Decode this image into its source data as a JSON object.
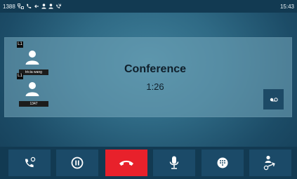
{
  "status_bar": {
    "account": "1388",
    "time": "15:43",
    "icons": [
      "network-icon",
      "phone-icon",
      "forward-icon",
      "user-icon",
      "user-icon",
      "missed-call-icon"
    ]
  },
  "conference": {
    "title": "Conference",
    "duration": "1:26",
    "participants": [
      {
        "line_badge": "L1",
        "name": "tricia wang",
        "icon": "avatar-icon"
      },
      {
        "line_badge": "L1",
        "name": "1347",
        "icon": "avatar-icon"
      }
    ],
    "side_action": {
      "icon": "voicemail-icon"
    }
  },
  "actions": [
    {
      "id": "new-call",
      "icon": "phone-plus-icon"
    },
    {
      "id": "hold",
      "icon": "pause-icon"
    },
    {
      "id": "end-call",
      "icon": "hangup-icon",
      "color": "#e8212b"
    },
    {
      "id": "mute",
      "icon": "microphone-icon"
    },
    {
      "id": "dialpad",
      "icon": "dialpad-icon"
    },
    {
      "id": "transfer",
      "icon": "transfer-icon"
    }
  ],
  "colors": {
    "status_bar": "#123a52",
    "panel": "#76aabe",
    "button": "#1b4a68",
    "hangup": "#e8212b"
  }
}
